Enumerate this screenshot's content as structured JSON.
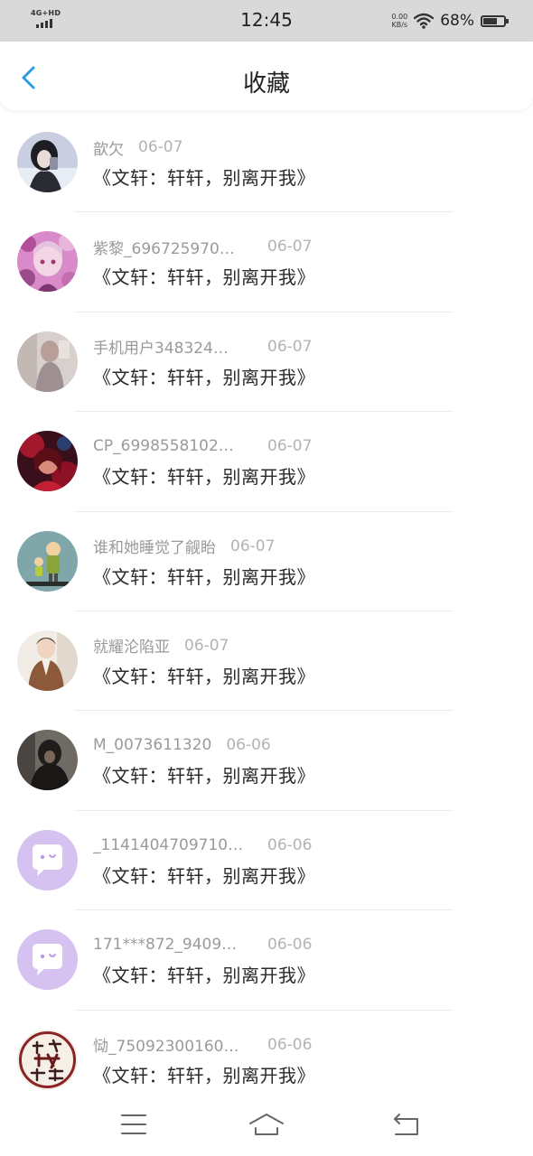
{
  "status_bar": {
    "network": "4G+HD",
    "time": "12:45",
    "speed_value": "0.00",
    "speed_unit": "KB/s",
    "battery_percent": "68%",
    "battery_level": 0.68,
    "icons": [
      "signal-icon",
      "wifi-icon",
      "battery-icon"
    ]
  },
  "header": {
    "title": "收藏",
    "back_icon": "chevron-left-icon",
    "accent_color": "#2a9de0"
  },
  "favorites": [
    {
      "user": "歆欠",
      "date": "06-07",
      "title": "《文轩：轩轩，别离开我》",
      "avatar": "photo-girl-mirror"
    },
    {
      "user": "紫黎_696725970…",
      "date": "06-07",
      "title": "《文轩：轩轩，别离开我》",
      "avatar": "anime-girl-flowers"
    },
    {
      "user": "手机用户348324…",
      "date": "06-07",
      "title": "《文轩：轩轩，别离开我》",
      "avatar": "photo-blurred"
    },
    {
      "user": "CP_6998558102…",
      "date": "06-07",
      "title": "《文轩：轩轩，别离开我》",
      "avatar": "anime-red-dark"
    },
    {
      "user": "谁和她睡觉了觎眙",
      "date": "06-07",
      "title": "《文轩：轩轩，别离开我》",
      "avatar": "cartoon-father-son"
    },
    {
      "user": "就耀沦陷亚",
      "date": "06-07",
      "title": "《文轩：轩轩，别离开我》",
      "avatar": "photo-man-coat"
    },
    {
      "user": "M_0073611320",
      "date": "06-06",
      "title": "《文轩：轩轩，别离开我》",
      "avatar": "photo-dark-hoodie"
    },
    {
      "user": "_1141404709710…",
      "date": "06-06",
      "title": "《文轩：轩轩，别离开我》",
      "avatar": "default-chat-bubble"
    },
    {
      "user": "171***872_9409…",
      "date": "06-06",
      "title": "《文轩：轩轩，别离开我》",
      "avatar": "default-chat-bubble"
    },
    {
      "user": "恸_75092300160…",
      "date": "06-06",
      "title": "《文轩：轩轩，别离开我》",
      "avatar": "calligraphy-seal"
    }
  ],
  "nav_bar": {
    "icons": [
      "menu-icon",
      "home-icon",
      "back-icon"
    ]
  }
}
